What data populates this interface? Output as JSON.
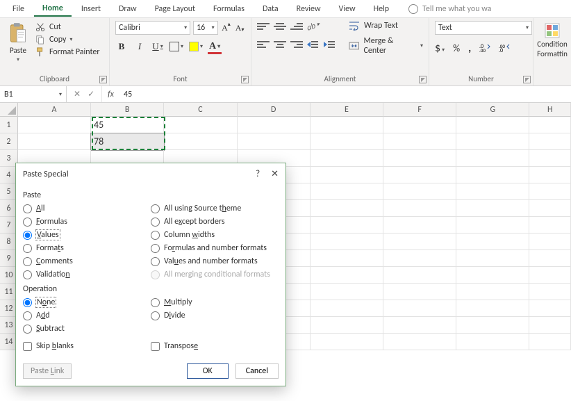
{
  "menu": {
    "items": [
      "File",
      "Home",
      "Insert",
      "Draw",
      "Page Layout",
      "Formulas",
      "Data",
      "Review",
      "View",
      "Help"
    ],
    "active_index": 1,
    "tellme_placeholder": "Tell me what you wa"
  },
  "ribbon": {
    "clipboard": {
      "label": "Clipboard",
      "paste": "Paste",
      "cut": "Cut",
      "copy": "Copy",
      "format_painter": "Format Painter"
    },
    "font": {
      "label": "Font",
      "name": "Calibri",
      "size": "16"
    },
    "alignment": {
      "label": "Alignment",
      "wrap": "Wrap Text",
      "merge": "Merge & Center"
    },
    "number": {
      "label": "Number",
      "format": "Text"
    },
    "cond": {
      "line1": "Condition",
      "line2": "Formattin"
    }
  },
  "formula_bar": {
    "name_box": "B1",
    "fx": "fx",
    "value": "45"
  },
  "grid": {
    "columns": [
      "A",
      "B",
      "C",
      "D",
      "E",
      "F",
      "G",
      "H"
    ],
    "rows": [
      1,
      2,
      3,
      4,
      5,
      6,
      7,
      8,
      9,
      10,
      11,
      12,
      13,
      14
    ],
    "cells": {
      "B1": "45",
      "B2": "78"
    }
  },
  "dialog": {
    "title": "Paste Special",
    "section_paste": "Paste",
    "section_operation": "Operation",
    "paste_options_left": [
      "All",
      "Formulas",
      "Values",
      "Formats",
      "Comments",
      "Validation"
    ],
    "paste_options_right": [
      "All using Source theme",
      "All except borders",
      "Column widths",
      "Formulas and number formats",
      "Values and number formats",
      "All merging conditional formats"
    ],
    "paste_selected": "Values",
    "paste_disabled": [
      "All merging conditional formats"
    ],
    "op_options_left": [
      "None",
      "Add",
      "Subtract"
    ],
    "op_options_right": [
      "Multiply",
      "Divide"
    ],
    "op_selected": "None",
    "skip_blanks": "Skip blanks",
    "transpose": "Transpose",
    "paste_link": "Paste Link",
    "ok": "OK",
    "cancel": "Cancel"
  }
}
